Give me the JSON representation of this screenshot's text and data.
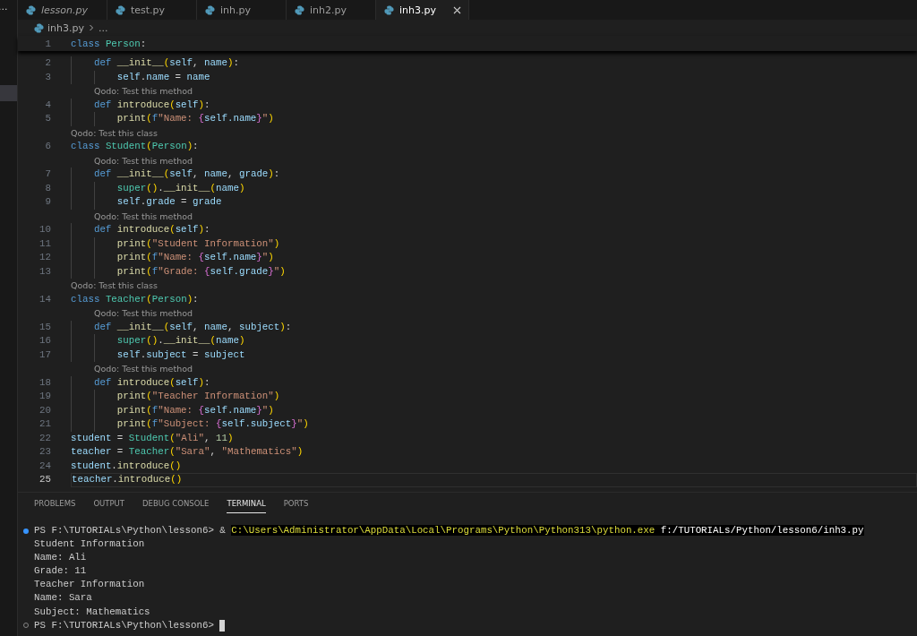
{
  "activity_bar": {
    "overflow": "..."
  },
  "tabs": [
    {
      "label": "lesson.py",
      "preview": true,
      "selected": false
    },
    {
      "label": "test.py",
      "preview": false,
      "selected": false
    },
    {
      "label": "inh.py",
      "preview": false,
      "selected": false
    },
    {
      "label": "inh2.py",
      "preview": false,
      "selected": false
    },
    {
      "label": "inh3.py",
      "preview": false,
      "selected": true
    }
  ],
  "breadcrumb": {
    "file": "inh3.py",
    "rest": "..."
  },
  "editor": {
    "sticky_line": {
      "number": "1",
      "tokens": [
        {
          "text": "class ",
          "kind": "kw"
        },
        {
          "text": "Person",
          "kind": "cls"
        },
        {
          "text": ":",
          "kind": "op"
        }
      ]
    },
    "rows": [
      {
        "kind": "code",
        "number": "2",
        "current": false,
        "tokens": [
          {
            "text": "    def ",
            "kind": "kw"
          },
          {
            "text": "__init__",
            "kind": "fn"
          },
          {
            "text": "(",
            "kind": "b1"
          },
          {
            "text": "self",
            "kind": "var"
          },
          {
            "text": ", ",
            "kind": "op"
          },
          {
            "text": "name",
            "kind": "var"
          },
          {
            "text": ")",
            "kind": "b1"
          },
          {
            "text": ":",
            "kind": "op"
          }
        ]
      },
      {
        "kind": "code",
        "number": "3",
        "current": false,
        "tokens": [
          {
            "text": "        self",
            "kind": "var"
          },
          {
            "text": ".",
            "kind": "op"
          },
          {
            "text": "name",
            "kind": "var"
          },
          {
            "text": " = ",
            "kind": "op"
          },
          {
            "text": "name",
            "kind": "var"
          }
        ]
      },
      {
        "kind": "lens",
        "nested": true,
        "text": "Qodo: Test this method"
      },
      {
        "kind": "code",
        "number": "4",
        "current": false,
        "tokens": [
          {
            "text": "    def ",
            "kind": "kw"
          },
          {
            "text": "introduce",
            "kind": "fn"
          },
          {
            "text": "(",
            "kind": "b1"
          },
          {
            "text": "self",
            "kind": "var"
          },
          {
            "text": ")",
            "kind": "b1"
          },
          {
            "text": ":",
            "kind": "op"
          }
        ]
      },
      {
        "kind": "code",
        "number": "5",
        "current": false,
        "tokens": [
          {
            "text": "        print",
            "kind": "fn"
          },
          {
            "text": "(",
            "kind": "b1"
          },
          {
            "text": "f",
            "kind": "kw"
          },
          {
            "text": "\"Name: ",
            "kind": "str"
          },
          {
            "text": "{",
            "kind": "b2"
          },
          {
            "text": "self.name",
            "kind": "var"
          },
          {
            "text": "}",
            "kind": "b2"
          },
          {
            "text": "\"",
            "kind": "str"
          },
          {
            "text": ")",
            "kind": "b1"
          }
        ]
      },
      {
        "kind": "lens",
        "nested": false,
        "text": "Qodo: Test this class"
      },
      {
        "kind": "code",
        "number": "6",
        "current": false,
        "tokens": [
          {
            "text": "class ",
            "kind": "kw"
          },
          {
            "text": "Student",
            "kind": "cls"
          },
          {
            "text": "(",
            "kind": "b1"
          },
          {
            "text": "Person",
            "kind": "cls"
          },
          {
            "text": ")",
            "kind": "b1"
          },
          {
            "text": ":",
            "kind": "op"
          }
        ]
      },
      {
        "kind": "lens",
        "nested": true,
        "text": "Qodo: Test this method"
      },
      {
        "kind": "code",
        "number": "7",
        "current": false,
        "tokens": [
          {
            "text": "    def ",
            "kind": "kw"
          },
          {
            "text": "__init__",
            "kind": "fn"
          },
          {
            "text": "(",
            "kind": "b1"
          },
          {
            "text": "self",
            "kind": "var"
          },
          {
            "text": ", ",
            "kind": "op"
          },
          {
            "text": "name",
            "kind": "var"
          },
          {
            "text": ", ",
            "kind": "op"
          },
          {
            "text": "grade",
            "kind": "var"
          },
          {
            "text": ")",
            "kind": "b1"
          },
          {
            "text": ":",
            "kind": "op"
          }
        ]
      },
      {
        "kind": "code",
        "number": "8",
        "current": false,
        "tokens": [
          {
            "text": "        super",
            "kind": "cls"
          },
          {
            "text": "()",
            "kind": "b1"
          },
          {
            "text": ".",
            "kind": "op"
          },
          {
            "text": "__init__",
            "kind": "fn"
          },
          {
            "text": "(",
            "kind": "b1"
          },
          {
            "text": "name",
            "kind": "var"
          },
          {
            "text": ")",
            "kind": "b1"
          }
        ]
      },
      {
        "kind": "code",
        "number": "9",
        "current": false,
        "tokens": [
          {
            "text": "        self",
            "kind": "var"
          },
          {
            "text": ".",
            "kind": "op"
          },
          {
            "text": "grade",
            "kind": "var"
          },
          {
            "text": " = ",
            "kind": "op"
          },
          {
            "text": "grade",
            "kind": "var"
          }
        ]
      },
      {
        "kind": "lens",
        "nested": true,
        "text": "Qodo: Test this method"
      },
      {
        "kind": "code",
        "number": "10",
        "current": false,
        "tokens": [
          {
            "text": "    def ",
            "kind": "kw"
          },
          {
            "text": "introduce",
            "kind": "fn"
          },
          {
            "text": "(",
            "kind": "b1"
          },
          {
            "text": "self",
            "kind": "var"
          },
          {
            "text": ")",
            "kind": "b1"
          },
          {
            "text": ":",
            "kind": "op"
          }
        ]
      },
      {
        "kind": "code",
        "number": "11",
        "current": false,
        "tokens": [
          {
            "text": "        print",
            "kind": "fn"
          },
          {
            "text": "(",
            "kind": "b1"
          },
          {
            "text": "\"Student Information\"",
            "kind": "str"
          },
          {
            "text": ")",
            "kind": "b1"
          }
        ]
      },
      {
        "kind": "code",
        "number": "12",
        "current": false,
        "tokens": [
          {
            "text": "        print",
            "kind": "fn"
          },
          {
            "text": "(",
            "kind": "b1"
          },
          {
            "text": "f",
            "kind": "kw"
          },
          {
            "text": "\"Name: ",
            "kind": "str"
          },
          {
            "text": "{",
            "kind": "b2"
          },
          {
            "text": "self.name",
            "kind": "var"
          },
          {
            "text": "}",
            "kind": "b2"
          },
          {
            "text": "\"",
            "kind": "str"
          },
          {
            "text": ")",
            "kind": "b1"
          }
        ]
      },
      {
        "kind": "code",
        "number": "13",
        "current": false,
        "tokens": [
          {
            "text": "        print",
            "kind": "fn"
          },
          {
            "text": "(",
            "kind": "b1"
          },
          {
            "text": "f",
            "kind": "kw"
          },
          {
            "text": "\"Grade: ",
            "kind": "str"
          },
          {
            "text": "{",
            "kind": "b2"
          },
          {
            "text": "self.grade",
            "kind": "var"
          },
          {
            "text": "}",
            "kind": "b2"
          },
          {
            "text": "\"",
            "kind": "str"
          },
          {
            "text": ")",
            "kind": "b1"
          }
        ]
      },
      {
        "kind": "lens",
        "nested": false,
        "text": "Qodo: Test this class"
      },
      {
        "kind": "code",
        "number": "14",
        "current": false,
        "tokens": [
          {
            "text": "class ",
            "kind": "kw"
          },
          {
            "text": "Teacher",
            "kind": "cls"
          },
          {
            "text": "(",
            "kind": "b1"
          },
          {
            "text": "Person",
            "kind": "cls"
          },
          {
            "text": ")",
            "kind": "b1"
          },
          {
            "text": ":",
            "kind": "op"
          }
        ]
      },
      {
        "kind": "lens",
        "nested": true,
        "text": "Qodo: Test this method"
      },
      {
        "kind": "code",
        "number": "15",
        "current": false,
        "tokens": [
          {
            "text": "    def ",
            "kind": "kw"
          },
          {
            "text": "__init__",
            "kind": "fn"
          },
          {
            "text": "(",
            "kind": "b1"
          },
          {
            "text": "self",
            "kind": "var"
          },
          {
            "text": ", ",
            "kind": "op"
          },
          {
            "text": "name",
            "kind": "var"
          },
          {
            "text": ", ",
            "kind": "op"
          },
          {
            "text": "subject",
            "kind": "var"
          },
          {
            "text": ")",
            "kind": "b1"
          },
          {
            "text": ":",
            "kind": "op"
          }
        ]
      },
      {
        "kind": "code",
        "number": "16",
        "current": false,
        "tokens": [
          {
            "text": "        super",
            "kind": "cls"
          },
          {
            "text": "()",
            "kind": "b1"
          },
          {
            "text": ".",
            "kind": "op"
          },
          {
            "text": "__init__",
            "kind": "fn"
          },
          {
            "text": "(",
            "kind": "b1"
          },
          {
            "text": "name",
            "kind": "var"
          },
          {
            "text": ")",
            "kind": "b1"
          }
        ]
      },
      {
        "kind": "code",
        "number": "17",
        "current": false,
        "tokens": [
          {
            "text": "        self",
            "kind": "var"
          },
          {
            "text": ".",
            "kind": "op"
          },
          {
            "text": "subject",
            "kind": "var"
          },
          {
            "text": " = ",
            "kind": "op"
          },
          {
            "text": "subject",
            "kind": "var"
          }
        ]
      },
      {
        "kind": "lens",
        "nested": true,
        "text": "Qodo: Test this method"
      },
      {
        "kind": "code",
        "number": "18",
        "current": false,
        "tokens": [
          {
            "text": "    def ",
            "kind": "kw"
          },
          {
            "text": "introduce",
            "kind": "fn"
          },
          {
            "text": "(",
            "kind": "b1"
          },
          {
            "text": "self",
            "kind": "var"
          },
          {
            "text": ")",
            "kind": "b1"
          },
          {
            "text": ":",
            "kind": "op"
          }
        ]
      },
      {
        "kind": "code",
        "number": "19",
        "current": false,
        "tokens": [
          {
            "text": "        print",
            "kind": "fn"
          },
          {
            "text": "(",
            "kind": "b1"
          },
          {
            "text": "\"Teacher Information\"",
            "kind": "str"
          },
          {
            "text": ")",
            "kind": "b1"
          }
        ]
      },
      {
        "kind": "code",
        "number": "20",
        "current": false,
        "tokens": [
          {
            "text": "        print",
            "kind": "fn"
          },
          {
            "text": "(",
            "kind": "b1"
          },
          {
            "text": "f",
            "kind": "kw"
          },
          {
            "text": "\"Name: ",
            "kind": "str"
          },
          {
            "text": "{",
            "kind": "b2"
          },
          {
            "text": "self.name",
            "kind": "var"
          },
          {
            "text": "}",
            "kind": "b2"
          },
          {
            "text": "\"",
            "kind": "str"
          },
          {
            "text": ")",
            "kind": "b1"
          }
        ]
      },
      {
        "kind": "code",
        "number": "21",
        "current": false,
        "tokens": [
          {
            "text": "        print",
            "kind": "fn"
          },
          {
            "text": "(",
            "kind": "b1"
          },
          {
            "text": "f",
            "kind": "kw"
          },
          {
            "text": "\"Subject: ",
            "kind": "str"
          },
          {
            "text": "{",
            "kind": "b2"
          },
          {
            "text": "self.subject",
            "kind": "var"
          },
          {
            "text": "}",
            "kind": "b2"
          },
          {
            "text": "\"",
            "kind": "str"
          },
          {
            "text": ")",
            "kind": "b1"
          }
        ]
      },
      {
        "kind": "code",
        "number": "22",
        "current": false,
        "tokens": [
          {
            "text": "student",
            "kind": "var"
          },
          {
            "text": " = ",
            "kind": "op"
          },
          {
            "text": "Student",
            "kind": "cls"
          },
          {
            "text": "(",
            "kind": "b1"
          },
          {
            "text": "\"Ali\"",
            "kind": "str"
          },
          {
            "text": ", ",
            "kind": "op"
          },
          {
            "text": "11",
            "kind": "num"
          },
          {
            "text": ")",
            "kind": "b1"
          }
        ]
      },
      {
        "kind": "code",
        "number": "23",
        "current": false,
        "tokens": [
          {
            "text": "teacher",
            "kind": "var"
          },
          {
            "text": " = ",
            "kind": "op"
          },
          {
            "text": "Teacher",
            "kind": "cls"
          },
          {
            "text": "(",
            "kind": "b1"
          },
          {
            "text": "\"Sara\"",
            "kind": "str"
          },
          {
            "text": ", ",
            "kind": "op"
          },
          {
            "text": "\"Mathematics\"",
            "kind": "str"
          },
          {
            "text": ")",
            "kind": "b1"
          }
        ]
      },
      {
        "kind": "code",
        "number": "24",
        "current": false,
        "tokens": [
          {
            "text": "student",
            "kind": "var"
          },
          {
            "text": ".",
            "kind": "op"
          },
          {
            "text": "introduce",
            "kind": "fn"
          },
          {
            "text": "()",
            "kind": "b1"
          }
        ]
      },
      {
        "kind": "code",
        "number": "25",
        "current": true,
        "tokens": [
          {
            "text": "teacher",
            "kind": "var"
          },
          {
            "text": ".",
            "kind": "op"
          },
          {
            "text": "introduce",
            "kind": "fn"
          },
          {
            "text": "()",
            "kind": "b1"
          }
        ]
      }
    ]
  },
  "panel": {
    "tabs": [
      {
        "label": "PROBLEMS",
        "selected": false
      },
      {
        "label": "OUTPUT",
        "selected": false
      },
      {
        "label": "DEBUG CONSOLE",
        "selected": false
      },
      {
        "label": "TERMINAL",
        "selected": true
      },
      {
        "label": "PORTS",
        "selected": false
      }
    ],
    "terminal": [
      {
        "kind": "command",
        "segments": [
          {
            "text": "PS F:\\TUTORIALs\\Python\\lesson6> & ",
            "kind": "plain"
          },
          {
            "text": "C:\\Users\\Administrator\\AppData\\Local\\Programs\\Python\\Python313\\python.exe",
            "kind": "hl-yellow"
          },
          {
            "text": " f:/TUTORIALs/Python/lesson6/inh3.py",
            "kind": "hl-white"
          }
        ]
      },
      {
        "kind": "output",
        "segments": [
          {
            "text": "Student Information",
            "kind": "plain"
          }
        ]
      },
      {
        "kind": "output",
        "segments": [
          {
            "text": "Name: Ali",
            "kind": "plain"
          }
        ]
      },
      {
        "kind": "output",
        "segments": [
          {
            "text": "Grade: 11",
            "kind": "plain"
          }
        ]
      },
      {
        "kind": "output",
        "segments": [
          {
            "text": "Teacher Information",
            "kind": "plain"
          }
        ]
      },
      {
        "kind": "output",
        "segments": [
          {
            "text": "Name: Sara",
            "kind": "plain"
          }
        ]
      },
      {
        "kind": "output",
        "segments": [
          {
            "text": "Subject: Mathematics",
            "kind": "plain"
          }
        ]
      },
      {
        "kind": "prompt",
        "segments": [
          {
            "text": "PS F:\\TUTORIALs\\Python\\lesson6> ",
            "kind": "plain"
          }
        ]
      }
    ]
  }
}
